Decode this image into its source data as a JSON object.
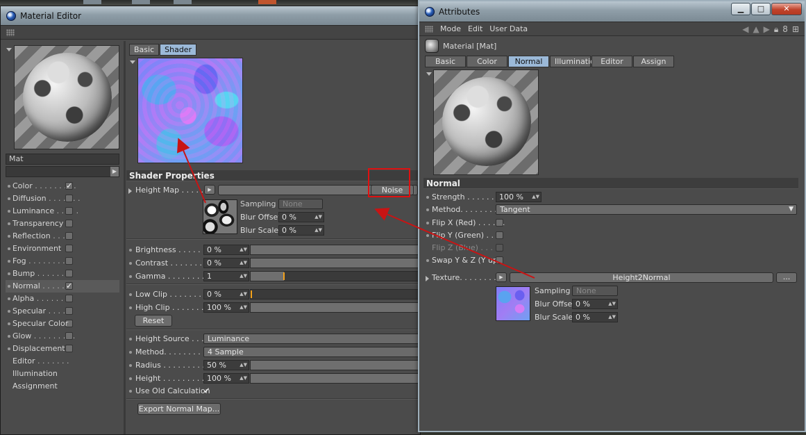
{
  "material_editor": {
    "title": "Material Editor",
    "material_name": "Mat",
    "channels": [
      {
        "label": "Color",
        "dots": " . . . . . . . . .",
        "checked": true
      },
      {
        "label": "Diffusion",
        "dots": " . . . . . . .",
        "checked": false
      },
      {
        "label": "Luminance",
        "dots": " . . . . .",
        "checked": false
      },
      {
        "label": "Transparency",
        "dots": "",
        "checked": false
      },
      {
        "label": "Reflection",
        "dots": " . . . .",
        "checked": false
      },
      {
        "label": "Environment",
        "dots": "",
        "checked": false
      },
      {
        "label": "Fog",
        "dots": " . . . . . . . . .",
        "checked": false
      },
      {
        "label": "Bump",
        "dots": " . . . . . . . .",
        "checked": false
      },
      {
        "label": "Normal",
        "dots": " . . . . . .",
        "checked": true
      },
      {
        "label": "Alpha",
        "dots": " . . . . . . . .",
        "checked": false
      },
      {
        "label": "Specular",
        "dots": " . . . . .",
        "checked": false
      },
      {
        "label": "Specular Color",
        "dots": "",
        "checked": false
      },
      {
        "label": "Glow",
        "dots": " . . . . . . . . .",
        "checked": false
      },
      {
        "label": "Displacement",
        "dots": "",
        "checked": false
      },
      {
        "label": "Editor",
        "dots": " . . . . . . .",
        "checked": null
      },
      {
        "label": "Illumination",
        "dots": "",
        "checked": null
      },
      {
        "label": "Assignment",
        "dots": "",
        "checked": null
      }
    ],
    "tabs": [
      {
        "label": "Basic",
        "active": false
      },
      {
        "label": "Shader",
        "active": true
      }
    ],
    "shader_properties_title": "Shader Properties",
    "height_map_label": "Height Map . . . . .",
    "height_map_shader": "Noise",
    "sampling_label": "Sampling",
    "sampling_value": "None",
    "blur_offset_label": "Blur Offset",
    "blur_offset_value": "0 %",
    "blur_scale_label": "Blur Scale",
    "blur_scale_value": "0 %",
    "brightness_label": "Brightness . . . . . . .",
    "brightness_value": "0 %",
    "contrast_label": "Contrast . . . . . . . .",
    "contrast_value": "0 %",
    "gamma_label": "Gamma . . . . . . . . .",
    "gamma_value": "1",
    "low_clip_label": "Low Clip . . . . . . . .",
    "low_clip_value": "0 %",
    "high_clip_label": "High Clip . . . . . . . .",
    "high_clip_value": "100 %",
    "reset_label": "Reset",
    "height_source_label": "Height Source . . . .",
    "height_source_value": "Luminance",
    "method_label": "Method. . . . . . . . . .",
    "method_value": "4 Sample",
    "radius_label": "Radius . . . . . . . . . .",
    "radius_value": "50 %",
    "height_label": "Height . . . . . . . . . .",
    "height_value": "100 %",
    "use_old_label": "Use Old Calculation",
    "use_old_checked": true,
    "export_label": "Export Normal Map..."
  },
  "attributes": {
    "title": "Attributes",
    "menu": [
      "Mode",
      "Edit",
      "User Data"
    ],
    "object_label": "Material [Mat]",
    "tabs": [
      {
        "label": "Basic",
        "active": false
      },
      {
        "label": "Color",
        "active": false
      },
      {
        "label": "Normal",
        "active": true
      },
      {
        "label": "Illumination",
        "active": false
      },
      {
        "label": "Editor",
        "active": false
      },
      {
        "label": "Assign",
        "active": false
      }
    ],
    "section_title": "Normal",
    "strength_label": "Strength . . . . . . . .",
    "strength_value": "100 %",
    "method_label": "Method. . . . . . . . . .",
    "method_value": "Tangent",
    "flip_x_label": "Flip X (Red) . . . . . .",
    "flip_y_label": "Flip Y (Green) . . . .",
    "flip_z_label": "Flip Z (Blue) . . . . .",
    "swap_label": "Swap Y & Z (Y up)",
    "texture_label": "Texture. . . . . . . . . .",
    "texture_value": "Height2Normal",
    "more_button": "...",
    "sampling_label": "Sampling",
    "sampling_value": "None",
    "blur_offset_label": "Blur Offset",
    "blur_offset_value": "0 %",
    "blur_scale_label": "Blur Scale",
    "blur_scale_value": "0 %"
  },
  "window_buttons": {
    "minimize": "▁",
    "maximize": "□",
    "close": "✕"
  },
  "colors": {
    "accent_tab": "#9bb9d8",
    "annotation_red": "#e01010",
    "gamma_marker": "#f4a21b"
  }
}
